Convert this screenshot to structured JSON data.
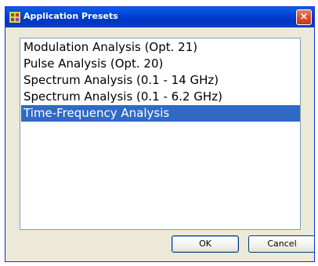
{
  "window": {
    "title": "Application Presets",
    "close_label": "×"
  },
  "list": {
    "items": [
      {
        "label": "Modulation Analysis (Opt. 21)",
        "selected": false
      },
      {
        "label": "Pulse Analysis (Opt. 20)",
        "selected": false
      },
      {
        "label": "Spectrum Analysis (0.1 - 14 GHz)",
        "selected": false
      },
      {
        "label": "Spectrum Analysis (0.1 - 6.2 GHz)",
        "selected": false
      },
      {
        "label": "Time-Frequency Analysis",
        "selected": true
      }
    ]
  },
  "buttons": {
    "ok_label": "OK",
    "cancel_label": "Cancel"
  },
  "colors": {
    "selection": "#316ac5",
    "titlebar": "#0040d0",
    "dialog_bg": "#ece9d8"
  }
}
